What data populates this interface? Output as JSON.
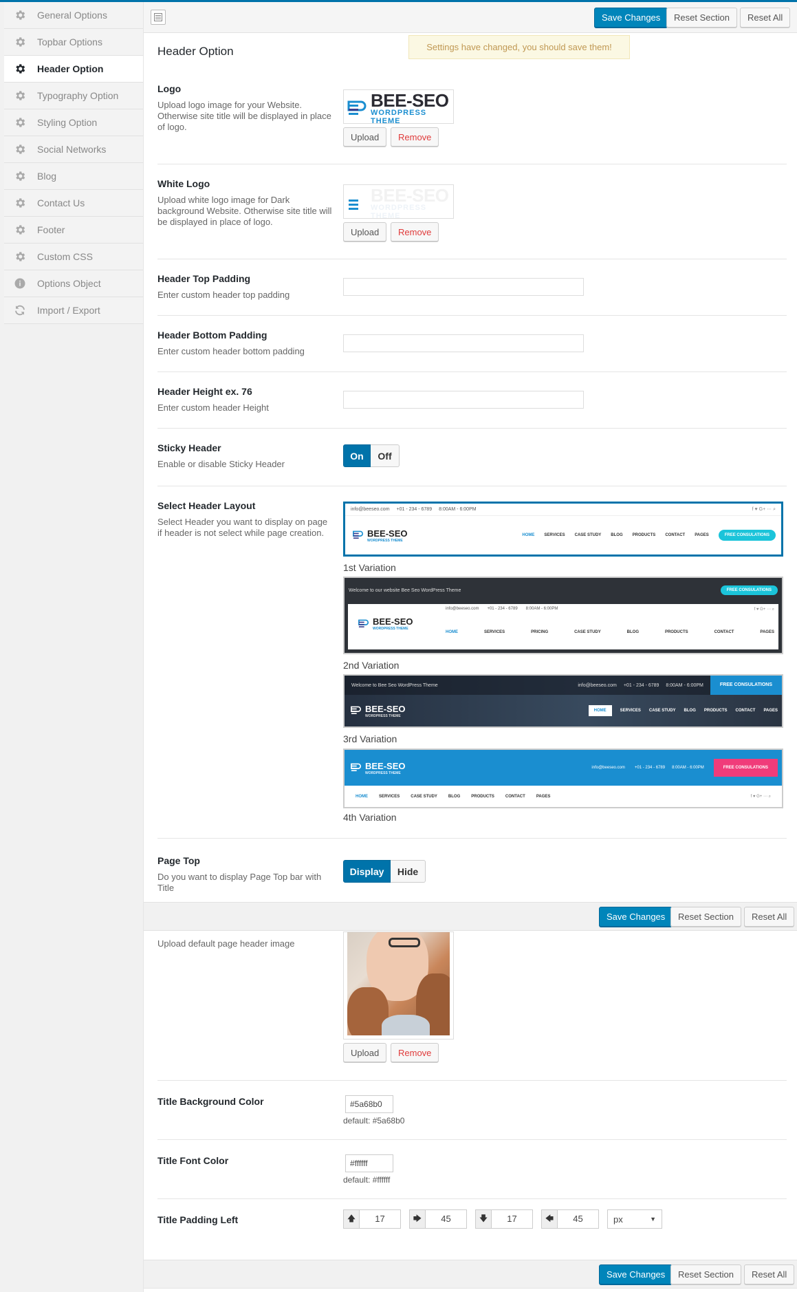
{
  "sidebar": {
    "items": [
      {
        "label": "General Options",
        "icon": "gear-icon"
      },
      {
        "label": "Topbar Options",
        "icon": "gear-icon"
      },
      {
        "label": "Header Option",
        "icon": "gear-icon",
        "active": true
      },
      {
        "label": "Typography Option",
        "icon": "gear-icon"
      },
      {
        "label": "Styling Option",
        "icon": "gear-icon"
      },
      {
        "label": "Social Networks",
        "icon": "gear-icon"
      },
      {
        "label": "Blog",
        "icon": "gear-icon"
      },
      {
        "label": "Contact Us",
        "icon": "gear-icon"
      },
      {
        "label": "Footer",
        "icon": "gear-icon"
      },
      {
        "label": "Custom CSS",
        "icon": "gear-icon"
      },
      {
        "label": "Options Object",
        "icon": "info-icon"
      },
      {
        "label": "Import / Export",
        "icon": "refresh-icon"
      }
    ]
  },
  "toolbar": {
    "save": "Save Changes",
    "reset_section": "Reset Section",
    "reset_all": "Reset All"
  },
  "notice": "Settings have changed, you should save them!",
  "section_title": "Header Option",
  "buttons": {
    "upload": "Upload",
    "remove": "Remove"
  },
  "fields": {
    "logo": {
      "title": "Logo",
      "desc": "Upload logo image for your Website. Otherwise site title will be displayed in place of logo."
    },
    "white_logo": {
      "title": "White Logo",
      "desc": "Upload white logo image for Dark background Website. Otherwise site title will be displayed in place of logo."
    },
    "top_padding": {
      "title": "Header Top Padding",
      "desc": "Enter custom header top padding",
      "value": ""
    },
    "bottom_padding": {
      "title": "Header Bottom Padding",
      "desc": "Enter custom header bottom padding",
      "value": ""
    },
    "height": {
      "title": "Header Height ex. 76",
      "desc": "Enter custom header Height",
      "value": ""
    },
    "sticky": {
      "title": "Sticky Header",
      "desc": "Enable or disable Sticky Header",
      "on": "On",
      "off": "Off",
      "selected": "On"
    },
    "layout": {
      "title": "Select Header Layout",
      "desc": "Select Header you want to display on page if header is not select while page creation.",
      "variations": [
        "1st Variation",
        "2nd Variation",
        "3rd Variation",
        "4th Variation"
      ],
      "selected": 0
    },
    "page_top": {
      "title": "Page Top",
      "desc": "Do you want to display Page Top bar with Title",
      "display": "Display",
      "hide": "Hide",
      "selected": "Display"
    },
    "page_header_image": {
      "desc": "Upload default page header image"
    },
    "title_bg": {
      "title": "Title Background Color",
      "value": "#5a68b0",
      "default": "default: #5a68b0"
    },
    "title_font": {
      "title": "Title Font Color",
      "value": "#ffffff",
      "default": "default: #ffffff"
    },
    "title_padding": {
      "title": "Title Padding Left",
      "top": "17",
      "right": "45",
      "bottom": "17",
      "left": "45",
      "unit": "px"
    }
  },
  "logo_image": {
    "brand": "BEE-SEO",
    "tagline": "WORDPRESS THEME"
  },
  "header_previews": {
    "email": "info@beeseo.com",
    "phone": "+01 - 234 - 6789",
    "hours": "8:00AM - 6:00PM",
    "welcome_2": "Welcome to our website Bee Seo WordPress Theme",
    "welcome_3": "Welcome to Bee Seo WordPress Theme",
    "cta": "FREE CONSULATIONS",
    "nav_1": [
      "HOME",
      "SERVICES",
      "CASE STUDY",
      "BLOG",
      "PRODUCTS",
      "CONTACT",
      "PAGES"
    ],
    "nav_2": [
      "HOME",
      "SERVICES",
      "PRICING",
      "CASE STUDY",
      "BLOG",
      "PRODUCTS",
      "CONTACT",
      "PAGES"
    ],
    "social": "f  ♥  G+  ⋯  ⌕"
  },
  "colors": {
    "accent": "#0073aa",
    "primary_button": "#0085ba",
    "cyan": "#1bc4da",
    "blue_header": "#1a8ed0",
    "pink": "#f03c7a",
    "dark": "#2e3238"
  }
}
